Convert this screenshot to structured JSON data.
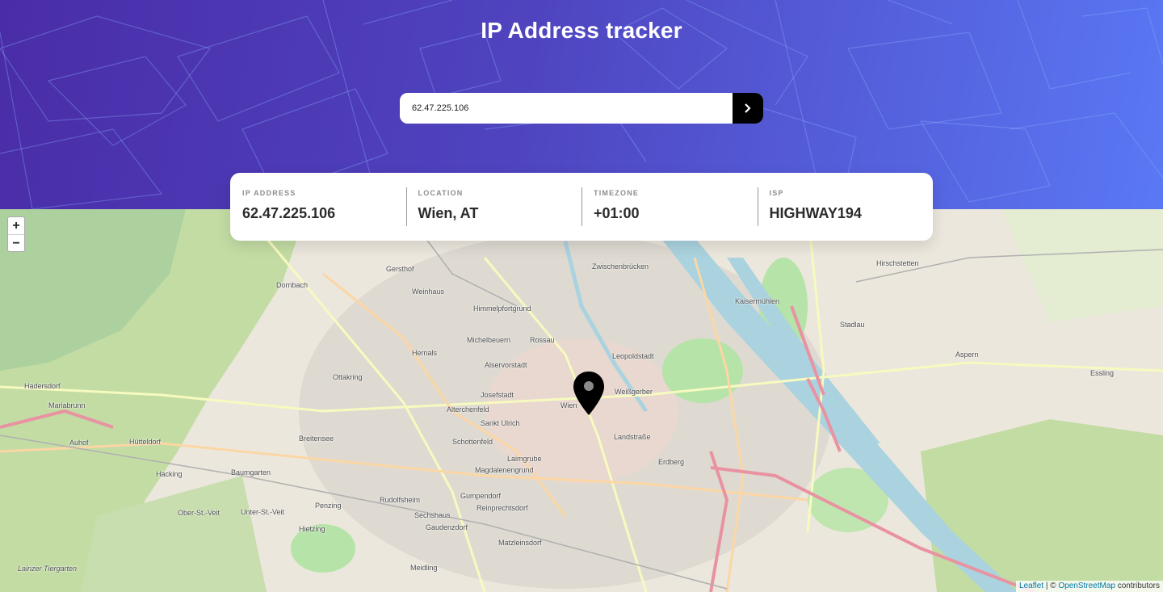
{
  "page": {
    "title": "IP Address tracker"
  },
  "search": {
    "value": "62.47.225.106",
    "button_icon": "chevron-right-icon"
  },
  "info": [
    {
      "label": "IP ADDRESS",
      "value": "62.47.225.106"
    },
    {
      "label": "LOCATION",
      "value": "Wien, AT"
    },
    {
      "label": "TIMEZONE",
      "value": "+01:00"
    },
    {
      "label": "ISP",
      "value": "HIGHWAY194"
    }
  ],
  "map": {
    "zoom_in": "+",
    "zoom_out": "−",
    "attribution": {
      "leaflet": "Leaflet",
      "sep": "| ©",
      "osm": "OpenStreetMap",
      "suffix": "contributors"
    },
    "places": [
      "Gersthof",
      "Weinhaus",
      "Dornbach",
      "Himmelpfortgrund",
      "Michelbeuern",
      "Rossau",
      "Hernals",
      "Alservorstadt",
      "Leopoldstadt",
      "Ottakring",
      "Josefstadt",
      "Wien",
      "Weißgerber",
      "Hadersdorf",
      "Mariabrunn",
      "Alterchenfeld",
      "Sankt Ulrich",
      "Breitensee",
      "Schottenfeld",
      "Landstraße",
      "Erdberg",
      "Hütteldorf",
      "Laimgrube",
      "Hacking",
      "Baumgarten",
      "Magdalenengrund",
      "Gumpendorf",
      "Reinprechtsdorf",
      "Rudolfsheim",
      "Penzing",
      "Ober-St.-Veit",
      "Unter-St.-Veit",
      "Sechshaus",
      "Gaudenzdorf",
      "Hietzing",
      "Matzleinsdorf",
      "Meidling",
      "Kaisermühlen",
      "Stadlau",
      "Aspern",
      "Essling",
      "Hirschstetten",
      "Zwischenbrücken",
      "Auhof",
      "Lainzer Tiergarten"
    ]
  },
  "colors": {
    "gradient_start": "#4a2ca8",
    "gradient_end": "#5a78f5",
    "button": "#000000"
  }
}
